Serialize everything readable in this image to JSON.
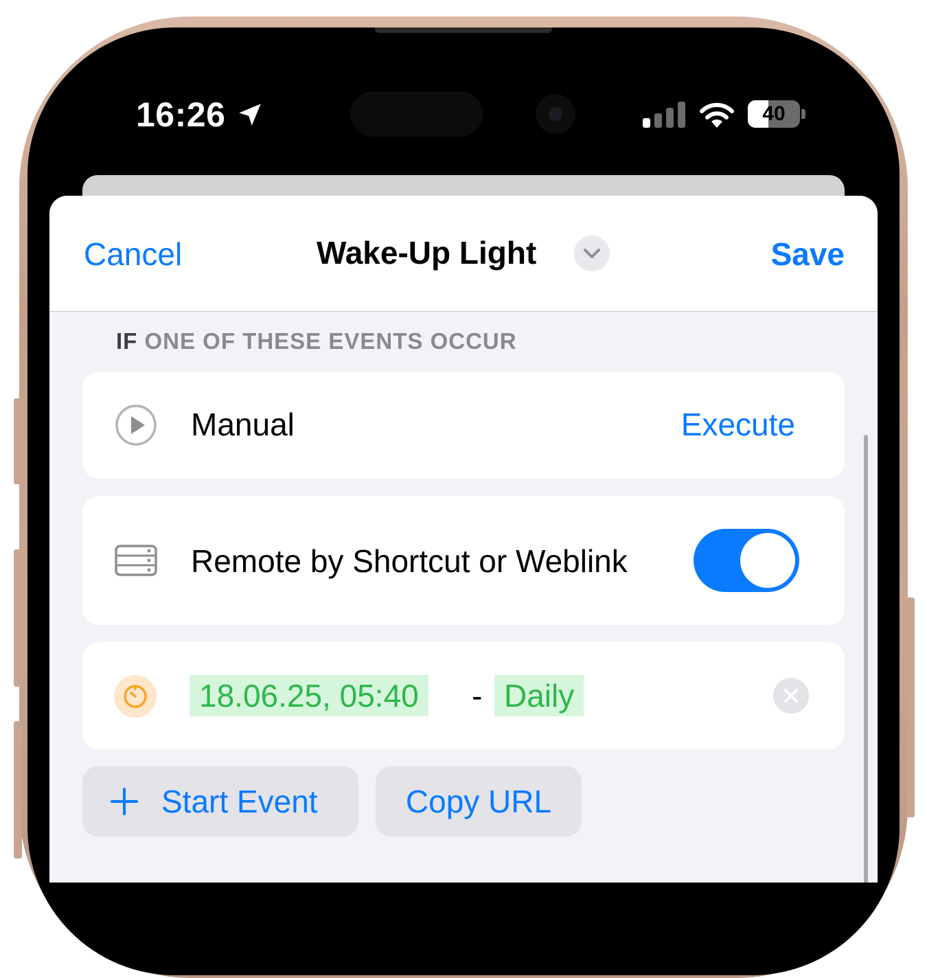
{
  "status_bar": {
    "time": "16:26",
    "battery_percent": "40",
    "battery_level": 0.4,
    "icons": [
      "location-arrow-icon",
      "cellular-signal-icon",
      "wifi-icon",
      "battery-icon"
    ]
  },
  "nav": {
    "cancel_label": "Cancel",
    "title": "Wake-Up Light",
    "save_label": "Save"
  },
  "section": {
    "keyword": "IF",
    "header": "ONE OF THESE EVENTS OCCUR"
  },
  "events": {
    "manual": {
      "label": "Manual",
      "action": "Execute",
      "icon": "play-circle-icon"
    },
    "remote": {
      "label": "Remote by Shortcut or Weblink",
      "enabled": true,
      "icon": "server-icon"
    },
    "timer": {
      "datetime": "18.06.25, 05:40",
      "separator": "-",
      "repeat": "Daily",
      "icon": "timer-icon"
    }
  },
  "actions": {
    "start_event_label": "Start Event",
    "copy_url_label": "Copy URL"
  },
  "colors": {
    "accent": "#0a7aff",
    "highlight_bg": "#d6f5dd",
    "highlight_text": "#2db84a",
    "timer_icon": "#f5a623"
  }
}
